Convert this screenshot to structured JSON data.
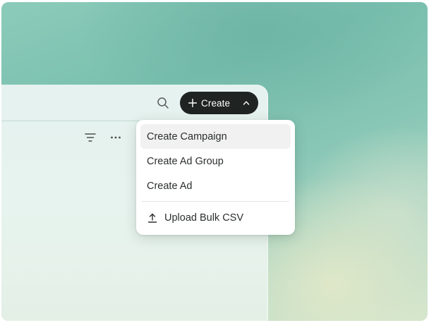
{
  "header": {
    "create_label": "Create"
  },
  "menu": {
    "items": [
      {
        "label": "Create Campaign"
      },
      {
        "label": "Create Ad Group"
      },
      {
        "label": "Create Ad"
      }
    ],
    "upload_label": "Upload Bulk CSV"
  },
  "icons": {
    "search": "search-icon",
    "plus": "plus-icon",
    "chevron": "chevron-up-icon",
    "filter": "filter-icon",
    "more": "more-horizontal-icon",
    "upload": "upload-icon"
  },
  "colors": {
    "primary_button": "#1f2322",
    "menu_highlight": "#f0f1f0"
  }
}
